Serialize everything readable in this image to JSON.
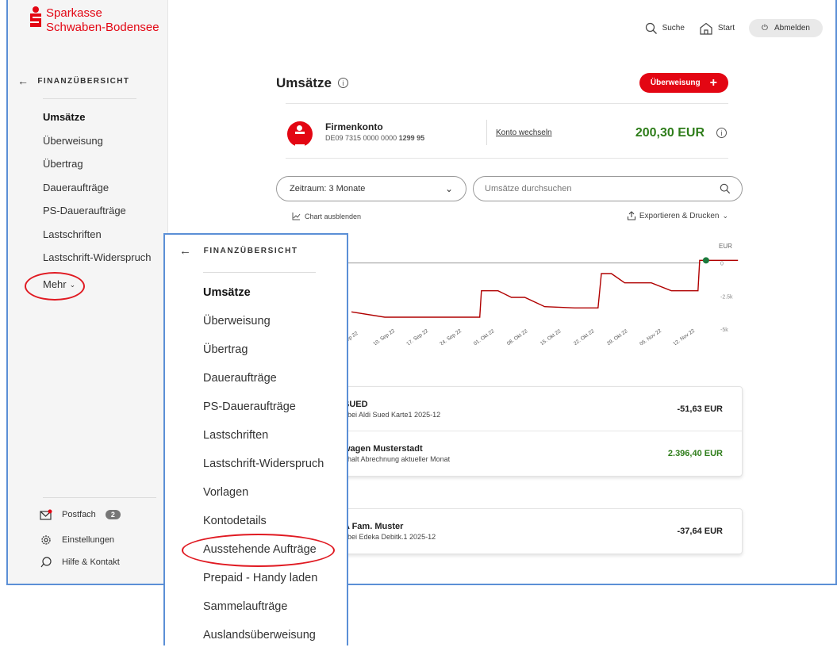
{
  "brand": {
    "line1": "Sparkasse",
    "line2": "Schwaben-Bodensee",
    "color": "#e30613"
  },
  "header": {
    "search_label": "Suche",
    "start_label": "Start",
    "logout_label": "Abmelden"
  },
  "sidebar": {
    "back_label": "FINANZÜBERSICHT",
    "items": [
      {
        "label": "Umsätze",
        "active": true
      },
      {
        "label": "Überweisung"
      },
      {
        "label": "Übertrag"
      },
      {
        "label": "Daueraufträge"
      },
      {
        "label": "PS-Daueraufträge"
      },
      {
        "label": "Lastschriften"
      },
      {
        "label": "Lastschrift-Widerspruch"
      }
    ],
    "more_label": "Mehr",
    "postfach_label": "Postfach",
    "postfach_count": "2",
    "settings_label": "Einstellungen",
    "help_label": "Hilfe & Kontakt"
  },
  "main": {
    "title": "Umsätze",
    "transfer_button": "Überweisung",
    "account": {
      "name": "Firmenkonto",
      "iban_prefix": "DE09 7315 0000 0000 ",
      "iban_suffix": "1299 95",
      "switch_label": "Konto wechseln",
      "balance": "200,30 EUR"
    },
    "period_select": "Zeitraum: 3 Monate",
    "search_placeholder": "Umsätze durchsuchen",
    "hide_chart_label": "Chart ausblenden",
    "export_label": "Exportieren & Drucken"
  },
  "chart_data": {
    "type": "line",
    "ylabel": "EUR",
    "y_ticks": [
      "0",
      "-2.5k",
      "-5k"
    ],
    "ylim": [
      -5000,
      1000
    ],
    "categories": [
      "Sep 22",
      "10. Sep 22",
      "17. Sep 22",
      "24. Sep 22",
      "01. Okt 22",
      "08. Okt 22",
      "15. Okt 22",
      "22. Okt 22",
      "29. Okt 22",
      "05. Nov 22",
      "12. Nov 22"
    ],
    "series": [
      {
        "x": [
          0,
          1,
          2,
          3.85,
          3.9,
          4.4,
          4.8,
          5.2,
          5.8,
          6.7,
          7.4,
          7.5,
          7.8,
          8.2,
          9.0,
          9.6,
          10.4,
          10.45,
          11.6
        ],
        "y": [
          -3700,
          -4100,
          -4100,
          -4100,
          -2100,
          -2100,
          -2600,
          -2600,
          -3300,
          -3400,
          -3400,
          -800,
          -800,
          -1500,
          -1500,
          -2100,
          -2100,
          200,
          200
        ]
      }
    ],
    "line_color": "#b00000",
    "marker_color": "#1b7a3c"
  },
  "transactions": [
    {
      "name": "SUED",
      "detail": "f bei Aldi Sued Karte1 2025-12",
      "amount": "-51,63 EUR",
      "positive": false
    },
    {
      "name": "wagen Musterstadt",
      "detail": "ehalt Abrechnung aktueller Monat",
      "amount": "2.396,40 EUR",
      "positive": true
    },
    {
      "name": "A Fam. Muster",
      "detail": "f bei Edeka Debitk.1 2025-12",
      "amount": "-37,64 EUR",
      "positive": false
    }
  ],
  "overlay": {
    "back_label": "FINANZÜBERSICHT",
    "items": [
      {
        "label": "Umsätze",
        "active": true
      },
      {
        "label": "Überweisung"
      },
      {
        "label": "Übertrag"
      },
      {
        "label": "Daueraufträge"
      },
      {
        "label": "PS-Daueraufträge"
      },
      {
        "label": "Lastschriften"
      },
      {
        "label": "Lastschrift-Widerspruch"
      },
      {
        "label": "Vorlagen"
      },
      {
        "label": "Kontodetails"
      },
      {
        "label": "Ausstehende Aufträge"
      },
      {
        "label": "Prepaid - Handy laden"
      },
      {
        "label": "Sammelaufträge"
      },
      {
        "label": "Auslandsüberweisung"
      }
    ]
  },
  "annotation_color": "#e01a22"
}
